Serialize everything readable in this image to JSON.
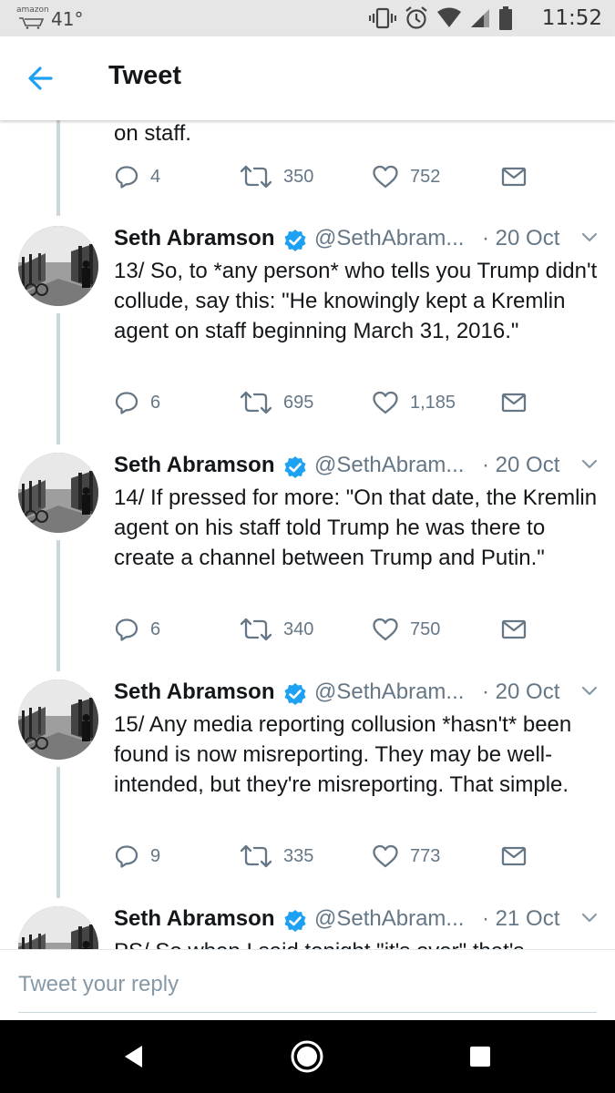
{
  "status_bar": {
    "amazon_label": "amazon",
    "temperature": "41°",
    "time": "11:52"
  },
  "header": {
    "title": "Tweet"
  },
  "thread_top": {
    "continuation_text": "on staff.",
    "replies": "4",
    "retweets": "350",
    "likes": "752"
  },
  "tweets": [
    {
      "name": "Seth Abramson",
      "handle": "@SethAbram...",
      "date": "· 20 Oct",
      "text": "13/ So, to *any person* who tells you Trump didn't collude, say this: \"He knowingly kept a Kremlin agent on staff beginning March 31, 2016.\"",
      "replies": "6",
      "retweets": "695",
      "likes": "1,185"
    },
    {
      "name": "Seth Abramson",
      "handle": "@SethAbram...",
      "date": "· 20 Oct",
      "text": "14/ If pressed for more: \"On that date, the Kremlin agent on his staff told Trump he was there to create a channel between Trump and Putin.\"",
      "replies": "6",
      "retweets": "340",
      "likes": "750"
    },
    {
      "name": "Seth Abramson",
      "handle": "@SethAbram...",
      "date": "· 20 Oct",
      "text": "15/ Any media reporting collusion *hasn't* been found is now misreporting. They may be well-intended, but they're misreporting. That simple.",
      "replies": "9",
      "retweets": "335",
      "likes": "773"
    },
    {
      "name": "Seth Abramson",
      "handle": "@SethAbram...",
      "date": "· 21 Oct",
      "text": "PS/ So when I said tonight \"it's over\" that's"
    }
  ],
  "reply_bar": {
    "placeholder": "Tweet your reply"
  },
  "colors": {
    "accent": "#1da1f2",
    "secondary_text": "#657786",
    "thread_line": "#ccd6dd"
  }
}
